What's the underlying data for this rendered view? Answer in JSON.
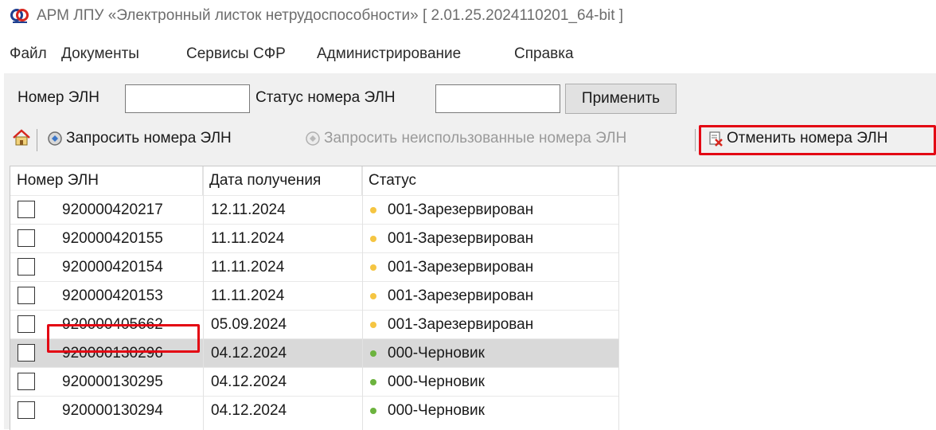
{
  "window": {
    "title": "АРМ ЛПУ «Электронный листок нетрудоспособности»  [ 2.01.25.2024110201_64-bit ]"
  },
  "menu": [
    "Файл",
    "Документы",
    "Сервисы СФР",
    "Администрирование",
    "Справка"
  ],
  "filter": {
    "eln_number_label": "Номер ЭЛН",
    "eln_number_value": "",
    "status_label": "Статус номера ЭЛН",
    "status_value": "",
    "apply_label": "Применить"
  },
  "toolbar": {
    "home_icon": "home-icon",
    "request_label": "Запросить номера ЭЛН",
    "request_unused_label": "Запросить неиспользованные номера ЭЛН",
    "cancel_label": "Отменить номера ЭЛН"
  },
  "table": {
    "headers": [
      "Номер ЭЛН",
      "Дата получения",
      "Статус"
    ],
    "rows": [
      {
        "number": "920000420217",
        "date": "12.11.2024",
        "status": "001-Зарезервирован",
        "status_color": "#f5c542",
        "checked": false,
        "selected": false
      },
      {
        "number": "920000420155",
        "date": "11.11.2024",
        "status": "001-Зарезервирован",
        "status_color": "#f5c542",
        "checked": false,
        "selected": false
      },
      {
        "number": "920000420154",
        "date": "11.11.2024",
        "status": "001-Зарезервирован",
        "status_color": "#f5c542",
        "checked": false,
        "selected": false
      },
      {
        "number": "920000420153",
        "date": "11.11.2024",
        "status": "001-Зарезервирован",
        "status_color": "#f5c542",
        "checked": false,
        "selected": false
      },
      {
        "number": "920000405662",
        "date": "05.09.2024",
        "status": "001-Зарезервирован",
        "status_color": "#f5c542",
        "checked": false,
        "selected": false
      },
      {
        "number": "920000130296",
        "date": "04.12.2024",
        "status": "000-Черновик",
        "status_color": "#6cb33e",
        "checked": false,
        "selected": true
      },
      {
        "number": "920000130295",
        "date": "04.12.2024",
        "status": "000-Черновик",
        "status_color": "#6cb33e",
        "checked": false,
        "selected": false
      },
      {
        "number": "920000130294",
        "date": "04.12.2024",
        "status": "000-Черновик",
        "status_color": "#6cb33e",
        "checked": false,
        "selected": false
      }
    ]
  },
  "colors": {
    "highlight": "#e30613",
    "reserved": "#f5c542",
    "draft": "#6cb33e"
  }
}
